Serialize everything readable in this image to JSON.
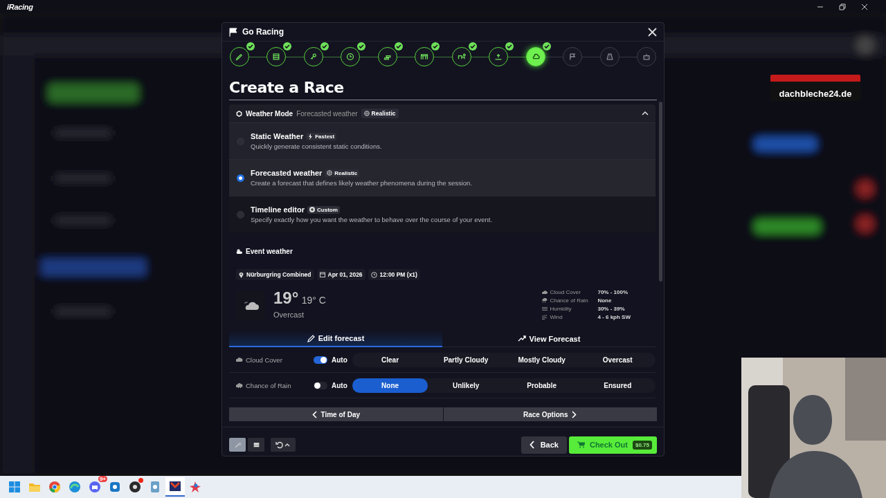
{
  "app": {
    "logo": "iRacing"
  },
  "dialog": {
    "title": "Go Racing",
    "steps": [
      {
        "done": true,
        "selected": false
      },
      {
        "done": true,
        "selected": false
      },
      {
        "done": true,
        "selected": false
      },
      {
        "done": true,
        "selected": false
      },
      {
        "done": true,
        "selected": false
      },
      {
        "done": true,
        "selected": false
      },
      {
        "done": true,
        "selected": false
      },
      {
        "done": true,
        "selected": false
      },
      {
        "done": true,
        "selected": true
      },
      {
        "done": false,
        "selected": false
      },
      {
        "done": false,
        "selected": false
      },
      {
        "done": false,
        "selected": false
      }
    ],
    "heading": "Create a Race",
    "weather_mode": {
      "label": "Weather Mode",
      "value": "Forecasted weather",
      "badge": "Realistic",
      "expanded": true,
      "options": [
        {
          "title": "Static Weather",
          "kind": "bolt",
          "badge": "Fastest",
          "description": "Quickly generate consistent static conditions.",
          "selected": false
        },
        {
          "title": "Forecasted weather",
          "kind": "globe",
          "badge": "Realistic",
          "description": "Create a forecast that defines likely weather phenomena during the session.",
          "selected": true
        },
        {
          "title": "Timeline editor",
          "kind": "plus",
          "badge": "Custom",
          "description": "Specify exactly how you want the weather to behave over the course of your event.",
          "selected": false
        }
      ]
    },
    "event_weather": {
      "title": "Event weather",
      "chips": [
        {
          "kind": "location",
          "text": "Nürburgring Combined"
        },
        {
          "kind": "date",
          "text": "Apr 01, 2026"
        },
        {
          "kind": "time",
          "text": "12:00 PM (x1)"
        }
      ],
      "temperature": "19°",
      "temperature_c": "19° C",
      "condition": "Overcast",
      "stats": [
        {
          "kind": "cloud",
          "label": "Cloud Cover",
          "value": "70% - 100%"
        },
        {
          "kind": "rain",
          "label": "Chance of Rain",
          "value": "None"
        },
        {
          "kind": "humidity",
          "label": "Humidity",
          "value": "30% - 39%"
        },
        {
          "kind": "wind",
          "label": "Wind",
          "value": "4 - 6 kph SW"
        }
      ]
    },
    "forecast_tabs": [
      {
        "kind": "edit",
        "label": "Edit forecast",
        "selected": true
      },
      {
        "kind": "chart",
        "label": "View Forecast",
        "selected": false
      }
    ],
    "settings": [
      {
        "kind": "cloud",
        "label": "Cloud Cover",
        "auto": true,
        "auto_label": "Auto",
        "options": [
          {
            "label": "Clear",
            "selected": false
          },
          {
            "label": "Partly Cloudy",
            "selected": false
          },
          {
            "label": "Mostly Cloudy",
            "selected": false
          },
          {
            "label": "Overcast",
            "selected": false
          }
        ]
      },
      {
        "kind": "rain",
        "label": "Chance of Rain",
        "auto": false,
        "auto_label": "Auto",
        "options": [
          {
            "label": "None",
            "selected": true
          },
          {
            "label": "Unlikely",
            "selected": false
          },
          {
            "label": "Probable",
            "selected": false
          },
          {
            "label": "Ensured",
            "selected": false
          }
        ]
      }
    ],
    "nav": {
      "previous": "Time of Day",
      "next": "Race Options"
    },
    "tools": [
      {
        "kind": "wand",
        "selected": true
      },
      {
        "kind": "list",
        "selected": false
      }
    ],
    "back": "Back",
    "checkout": {
      "label": "Check Out",
      "price": "$0.75"
    }
  },
  "overlay": {
    "logo": "dachbleche24.de"
  },
  "taskbar": {
    "apps": [
      {
        "kind": "start",
        "selected": false,
        "notification": false
      },
      {
        "kind": "folder",
        "selected": false,
        "notification": false
      },
      {
        "kind": "chrome",
        "selected": false,
        "notification": false
      },
      {
        "kind": "edge",
        "selected": false,
        "notification": false
      },
      {
        "kind": "discord",
        "selected": false,
        "notification": false,
        "badge": "9+"
      },
      {
        "kind": "shield",
        "selected": false,
        "notification": false
      },
      {
        "kind": "obs",
        "selected": false,
        "notification": true
      },
      {
        "kind": "puzzle",
        "selected": false,
        "notification": false
      },
      {
        "kind": "iracing",
        "selected": true,
        "notification": false
      },
      {
        "kind": "star",
        "selected": false,
        "notification": false
      }
    ]
  }
}
